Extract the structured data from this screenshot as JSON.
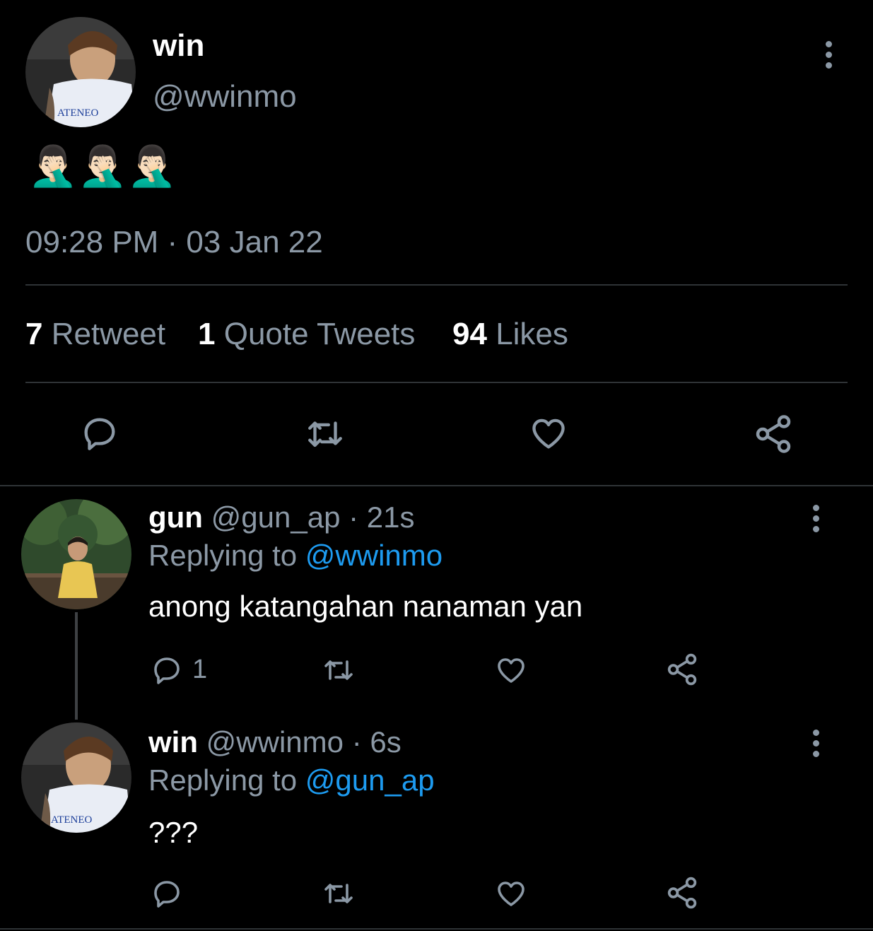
{
  "main_tweet": {
    "display_name": "win",
    "handle": "@wwinmo",
    "avatar_label": "ATENEO",
    "content_emoji": [
      "🤦🏻‍♂️",
      "🤦🏻‍♂️",
      "🤦🏻‍♂️"
    ],
    "timestamp": "09:28 PM · 03 Jan 22",
    "stats": {
      "retweet_count": "7",
      "retweet_label": "Retweet",
      "quote_count": "1",
      "quote_label": "Quote Tweets",
      "likes_count": "94",
      "likes_label": "Likes"
    },
    "actions": [
      "reply-icon",
      "retweet-icon",
      "like-icon",
      "share-icon"
    ]
  },
  "replies": [
    {
      "display_name": "gun",
      "handle": "@gun_ap",
      "time": "· 21s",
      "replying_prefix": "Replying to",
      "replying_to": "@wwinmo",
      "text": "anong katangahan nanaman yan",
      "reply_count": "1"
    },
    {
      "display_name": "win",
      "handle": "@wwinmo",
      "time": "· 6s",
      "replying_prefix": "Replying to",
      "replying_to": "@gun_ap",
      "text": "???",
      "avatar_label": "ATENEO",
      "reply_count": ""
    }
  ],
  "colors": {
    "background": "#000000",
    "text": "#ffffff",
    "secondary": "#8b98a5",
    "accent": "#1d9bf0",
    "divider": "#2f3336"
  }
}
